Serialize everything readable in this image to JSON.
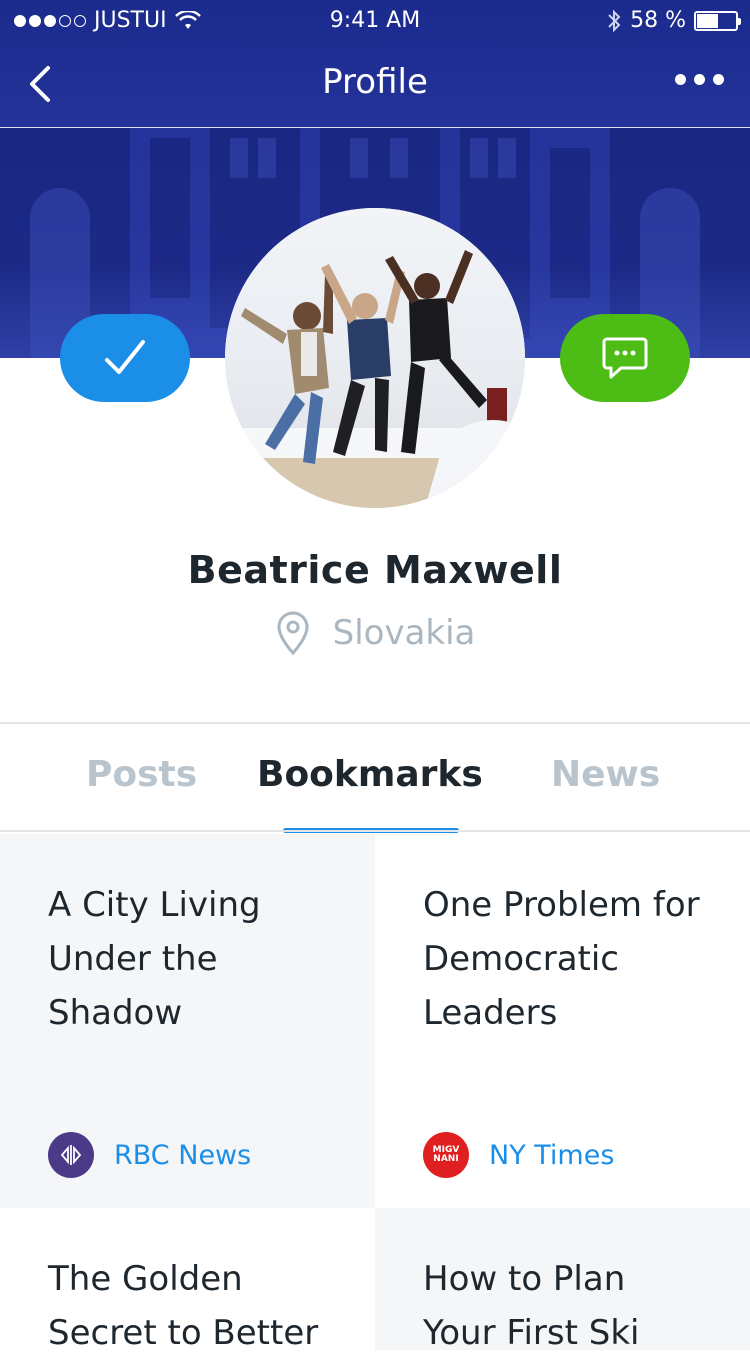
{
  "status": {
    "carrier": "JUSTUI",
    "time": "9:41 AM",
    "battery": "58 %",
    "battery_level": 0.58
  },
  "nav": {
    "title": "Profile"
  },
  "profile": {
    "name": "Beatrice Maxwell",
    "location": "Slovakia"
  },
  "tabs": [
    {
      "label": "Posts",
      "active": false
    },
    {
      "label": "Bookmarks",
      "active": true
    },
    {
      "label": "News",
      "active": false
    }
  ],
  "bookmarks": [
    {
      "title": "A City Living Under the Shadow",
      "source": "RBC News",
      "logo_text": ""
    },
    {
      "title": "One Problem for Democratic Leaders",
      "source": "NY Times",
      "logo_text": "MIGV NANI"
    },
    {
      "title": "The Golden Secret to Better",
      "source": ""
    },
    {
      "title": "How to Plan Your First Ski",
      "source": ""
    }
  ],
  "colors": {
    "accent": "#1b8ee8",
    "success": "#4dbd16",
    "header": "#24349a"
  }
}
